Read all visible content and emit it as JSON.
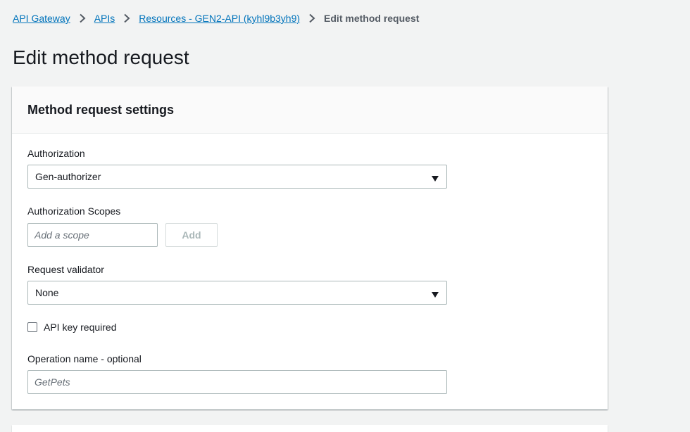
{
  "breadcrumb": {
    "items": [
      "API Gateway",
      "APIs",
      "Resources - GEN2-API (kyhl9b3yh9)"
    ],
    "current": "Edit method request"
  },
  "page": {
    "title": "Edit method request"
  },
  "panel": {
    "title": "Method request settings",
    "authorization": {
      "label": "Authorization",
      "value": "Gen-authorizer"
    },
    "scopes": {
      "label": "Authorization Scopes",
      "placeholder": "Add a scope",
      "add_label": "Add"
    },
    "validator": {
      "label": "Request validator",
      "value": "None"
    },
    "api_key": {
      "label": "API key required",
      "checked": false
    },
    "operation": {
      "label": "Operation name - optional",
      "placeholder": "GetPets"
    }
  },
  "colors": {
    "link": "#0073bb",
    "background": "#f2f3f3",
    "border": "#aab7b8"
  }
}
